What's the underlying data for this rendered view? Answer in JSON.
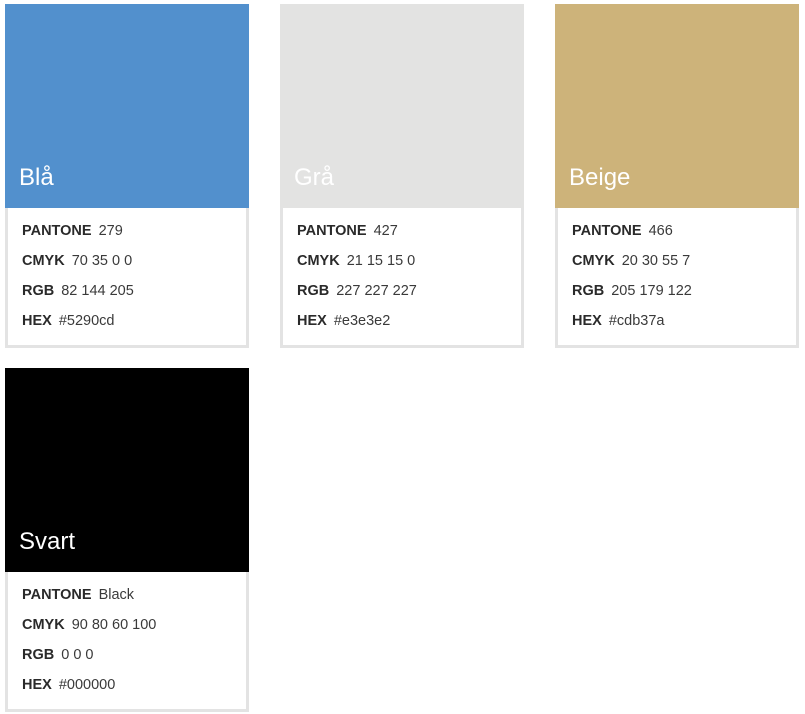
{
  "labels": {
    "pantone": "PANTONE",
    "cmyk": "CMYK",
    "rgb": "RGB",
    "hex": "HEX"
  },
  "colors": [
    {
      "name": "Blå",
      "swatch": "#5290cd",
      "pantone": "279",
      "cmyk": "70 35 0 0",
      "rgb": "82 144 205",
      "hex": "#5290cd"
    },
    {
      "name": "Grå",
      "swatch": "#e3e3e2",
      "pantone": "427",
      "cmyk": "21 15 15 0",
      "rgb": "227 227 227",
      "hex": "#e3e3e2"
    },
    {
      "name": "Beige",
      "swatch": "#cdb37a",
      "pantone": "466",
      "cmyk": "20 30 55 7",
      "rgb": "205 179 122",
      "hex": "#cdb37a"
    },
    {
      "name": "Svart",
      "swatch": "#000000",
      "pantone": "Black",
      "cmyk": "90 80 60 100",
      "rgb": "0 0 0",
      "hex": "#000000"
    }
  ]
}
